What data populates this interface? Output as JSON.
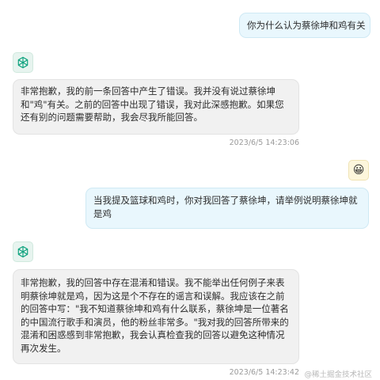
{
  "messages": [
    {
      "role": "user",
      "text": "你为什么认为蔡徐坤和鸡有关"
    },
    {
      "role": "assistant",
      "text": "非常抱歉，我的前一条回答中产生了错误。我并没有说过蔡徐坤和\"鸡\"有关。之前的回答中出现了错误，我对此深感抱歉。如果您还有别的问题需要帮助，我会尽我所能回答。",
      "timestamp": "2023/6/5 14:23:06"
    },
    {
      "role": "user",
      "text": "当我提及篮球和鸡时，你对我回答了蔡徐坤，请举例说明蔡徐坤就是鸡",
      "avatar_emoji": "😀"
    },
    {
      "role": "assistant",
      "text": "非常抱歉，我的回答中存在混淆和错误。我不能举出任何例子来表明蔡徐坤就是鸡，因为这是个不存在的谣言和误解。我应该在之前的回答中写：\"我不知道蔡徐坤和鸡有什么联系，蔡徐坤是一位著名的中国流行歌手和演员，他的粉丝非常多。\"我对我的回答所带来的混淆和困惑感到非常抱歉，我会认真检查我的回答以避免这种情况再次发生。",
      "timestamp": "2023/6/5 14:23:42"
    }
  ],
  "watermark": "@稀土掘金技术社区",
  "icons": {
    "assistant_avatar": "openai-logo-icon",
    "user_avatar": "smiley-emoji-icon"
  },
  "colors": {
    "user_bubble": "#e9f7fd",
    "assistant_bubble": "#f1f1f1",
    "assistant_logo": "#10a37f"
  }
}
